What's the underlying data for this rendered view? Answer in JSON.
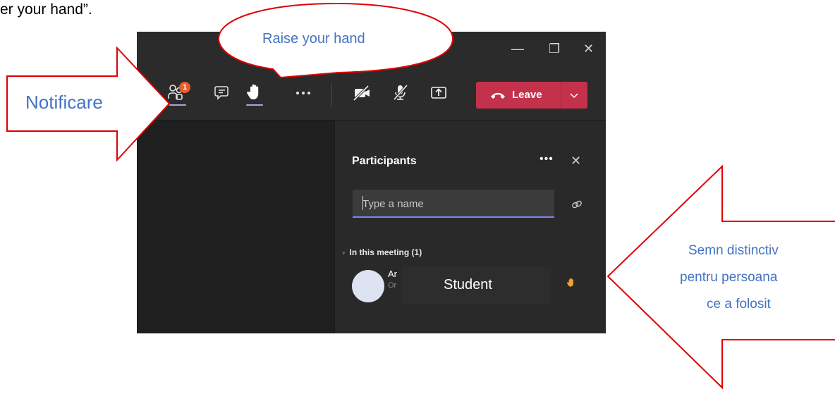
{
  "document": {
    "top_text": "er your hand”."
  },
  "window": {
    "controls": {
      "minimize": "—",
      "restore": "❐",
      "close": "✕"
    }
  },
  "toolbar": {
    "participants_badge": "1",
    "leave_label": "Leave"
  },
  "panel": {
    "title": "Participants",
    "search_placeholder": "Type a name",
    "section_label": "In this meeting (1)",
    "participant": {
      "name_partial": "Ar",
      "status_partial": "Or",
      "cover_label": "Student"
    }
  },
  "annotations": {
    "bubble": "Raise your hand",
    "left_arrow": "Notificare",
    "right_arrow": [
      "Semn distinctiv",
      "pentru persoana",
      "ce a folosit"
    ]
  },
  "colors": {
    "accent": "#7f85f5",
    "leave": "#c4314b",
    "badge": "#e85d2a",
    "annotation_outline": "#e00000",
    "annotation_text": "#4472c4",
    "hand": "#f0a030"
  }
}
